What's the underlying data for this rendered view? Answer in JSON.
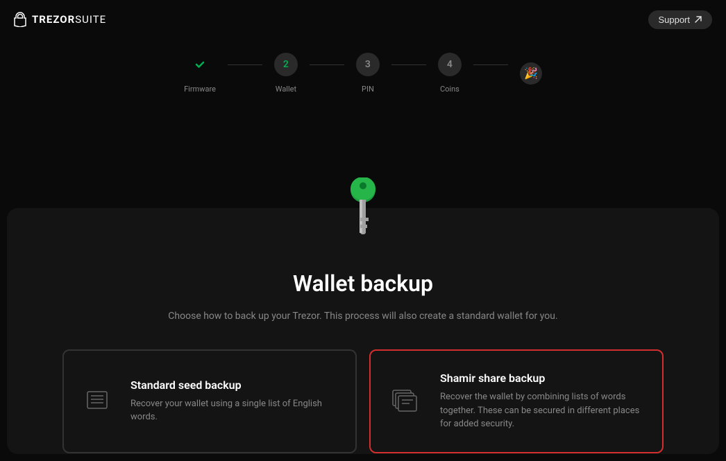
{
  "header": {
    "brand_bold": "TREZOR",
    "brand_light": "SUITE",
    "support_label": "Support"
  },
  "stepper": {
    "steps": [
      {
        "label": "Firmware",
        "state": "done"
      },
      {
        "number": "2",
        "label": "Wallet",
        "state": "active"
      },
      {
        "number": "3",
        "label": "PIN",
        "state": "pending"
      },
      {
        "number": "4",
        "label": "Coins",
        "state": "pending"
      }
    ],
    "final_emoji": "🎉"
  },
  "main": {
    "title": "Wallet backup",
    "subtitle": "Choose how to back up your Trezor. This process will also create a standard wallet for you.",
    "options": [
      {
        "title": "Standard seed backup",
        "description": "Recover your wallet using a single list of English words.",
        "selected": false
      },
      {
        "title": "Shamir share backup",
        "description": "Recover the wallet by combining lists of words together. These can be secured in different places for added security.",
        "selected": true
      }
    ]
  }
}
